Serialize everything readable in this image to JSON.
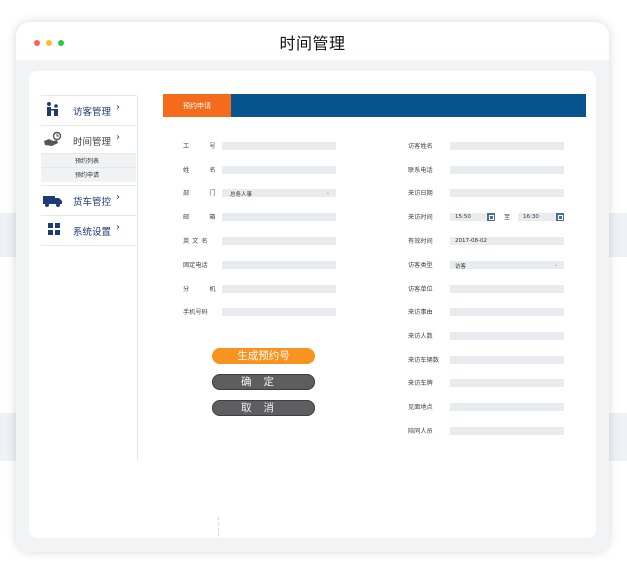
{
  "window": {
    "title": "时间管理"
  },
  "colors": {
    "accent_orange": "#f46c1b",
    "header_blue": "#05538f",
    "nav_text": "#1f3b74",
    "generate_button": "#f7931e",
    "dark_button": "#5e5e60"
  },
  "sidebar": {
    "items": [
      {
        "label": "访客管理",
        "icon": "visitor-icon",
        "chevron": "›"
      },
      {
        "label": "时间管理",
        "icon": "hand-clock-icon",
        "chevron": "›"
      },
      {
        "label": "货车管控",
        "icon": "truck-icon",
        "chevron": "›"
      },
      {
        "label": "系统设置",
        "icon": "settings-grid-icon",
        "chevron": "›"
      }
    ],
    "subitems": [
      "预约列表",
      "预约申请"
    ]
  },
  "form": {
    "tab": "预约申请",
    "left": {
      "employee_id": "工　号",
      "name": "姓　名",
      "department": "部　门",
      "department_value": "总务人事",
      "email": "邮　箱",
      "english_name": "英文名",
      "landline": "固定电话",
      "extension": "分　机",
      "mobile": "手机号码"
    },
    "right": {
      "visitor_name": "访客姓名",
      "contact_phone": "联系电话",
      "visit_date": "来访日期",
      "visit_time": "来访时间",
      "time_from": "15:50",
      "time_to_sep": "至",
      "time_to": "16:30",
      "valid_time": "有效时间",
      "valid_value": "2017-08-02",
      "visitor_type": "访客类型",
      "visitor_type_value": "访客",
      "visitor_company": "访客单位",
      "visit_reason": "来访事由",
      "visitor_count": "来访人数",
      "vehicle_count": "来访车辆数",
      "license_plate": "来访车牌",
      "meeting_place": "见面地点",
      "accompanying": "陪同人员"
    },
    "buttons": {
      "generate": "生成预约号",
      "confirm": "确定",
      "cancel": "取消"
    }
  }
}
